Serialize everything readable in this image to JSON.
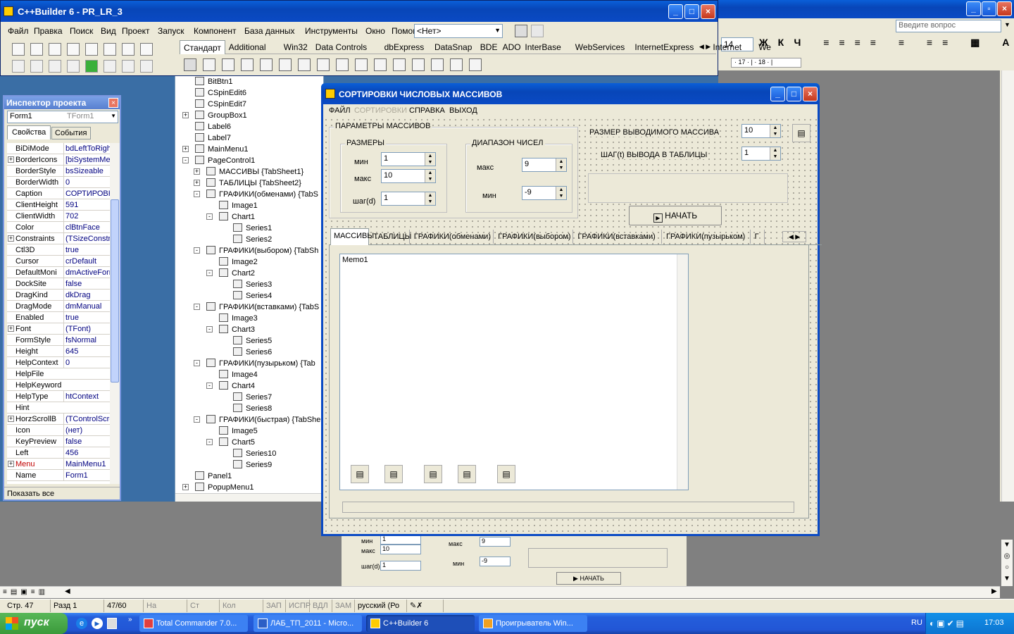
{
  "ide": {
    "title": "C++Builder 6 - PR_LR_3",
    "menu": [
      "Файл",
      "Правка",
      "Поиск",
      "Вид",
      "Проект",
      "Запуск",
      "Компонент",
      "База данных",
      "Инструменты",
      "Окно",
      "Помощь"
    ],
    "combo": "<Нет>",
    "palette_tabs": [
      "Стандарт",
      "Additional",
      "Win32",
      "Data Controls",
      "dbExpress",
      "DataSnap",
      "BDE",
      "ADO",
      "InterBase",
      "WebServices",
      "InternetExpress",
      "Internet",
      "We"
    ]
  },
  "word": {
    "question_placeholder": "Введите вопрос",
    "font_size": "14",
    "ruler": "· 17 · | · 18 · |"
  },
  "inspector": {
    "title": "Инспектор проекта",
    "object": "Form1",
    "object_type": "TForm1",
    "tab_props": "Свойства",
    "tab_events": "События",
    "footer": "Показать все",
    "rows": [
      {
        "name": "BiDiMode",
        "value": "bdLeftToRight",
        "plus": false
      },
      {
        "name": "BorderIcons",
        "value": "[biSystemMenu",
        "plus": true
      },
      {
        "name": "BorderStyle",
        "value": "bsSizeable",
        "plus": false
      },
      {
        "name": "BorderWidth",
        "value": "0",
        "plus": false
      },
      {
        "name": "Caption",
        "value": "СОРТИРОВКИ",
        "plus": false
      },
      {
        "name": "ClientHeight",
        "value": "591",
        "plus": false
      },
      {
        "name": "ClientWidth",
        "value": "702",
        "plus": false
      },
      {
        "name": "Color",
        "value": "clBtnFace",
        "plus": false
      },
      {
        "name": "Constraints",
        "value": "(TSizeConstrai",
        "plus": true
      },
      {
        "name": "Ctl3D",
        "value": "true",
        "plus": false
      },
      {
        "name": "Cursor",
        "value": "crDefault",
        "plus": false
      },
      {
        "name": "DefaultMoni",
        "value": "dmActiveForm",
        "plus": false
      },
      {
        "name": "DockSite",
        "value": "false",
        "plus": false
      },
      {
        "name": "DragKind",
        "value": "dkDrag",
        "plus": false
      },
      {
        "name": "DragMode",
        "value": "dmManual",
        "plus": false
      },
      {
        "name": "Enabled",
        "value": "true",
        "plus": false
      },
      {
        "name": "Font",
        "value": "(TFont)",
        "plus": true
      },
      {
        "name": "FormStyle",
        "value": "fsNormal",
        "plus": false
      },
      {
        "name": "Height",
        "value": "645",
        "plus": false
      },
      {
        "name": "HelpContext",
        "value": "0",
        "plus": false
      },
      {
        "name": "HelpFile",
        "value": "",
        "plus": false
      },
      {
        "name": "HelpKeyword",
        "value": "",
        "plus": false
      },
      {
        "name": "HelpType",
        "value": "htContext",
        "plus": false
      },
      {
        "name": "Hint",
        "value": "",
        "plus": false
      },
      {
        "name": "HorzScrollB",
        "value": "(TControlScroll",
        "plus": true
      },
      {
        "name": "Icon",
        "value": "(нет)",
        "plus": false
      },
      {
        "name": "KeyPreview",
        "value": "false",
        "plus": false
      },
      {
        "name": "Left",
        "value": "456",
        "plus": false
      },
      {
        "name": "Menu",
        "value": "MainMenu1",
        "plus": true
      },
      {
        "name": "Name",
        "value": "Form1",
        "plus": false
      }
    ]
  },
  "tree": [
    {
      "text": "BitBtn1",
      "level": 0,
      "exp": ""
    },
    {
      "text": "CSpinEdit6",
      "level": 0,
      "exp": ""
    },
    {
      "text": "CSpinEdit7",
      "level": 0,
      "exp": ""
    },
    {
      "text": "GroupBox1",
      "level": 0,
      "exp": "+"
    },
    {
      "text": "Label6",
      "level": 0,
      "exp": ""
    },
    {
      "text": "Label7",
      "level": 0,
      "exp": ""
    },
    {
      "text": "MainMenu1",
      "level": 0,
      "exp": "+"
    },
    {
      "text": "PageControl1",
      "level": 0,
      "exp": "-"
    },
    {
      "text": "МАССИВЫ {TabSheet1}",
      "level": 1,
      "exp": "+"
    },
    {
      "text": "ТАБЛИЦЫ {TabSheet2}",
      "level": 1,
      "exp": "+"
    },
    {
      "text": "ГРАФИКИ(обменами) {TabS",
      "level": 1,
      "exp": "-"
    },
    {
      "text": "Image1",
      "level": 2,
      "exp": ""
    },
    {
      "text": "Chart1",
      "level": 2,
      "exp": "-"
    },
    {
      "text": "Series1",
      "level": 3,
      "exp": ""
    },
    {
      "text": "Series2",
      "level": 3,
      "exp": ""
    },
    {
      "text": "ГРАФИКИ(выбором) {TabSh",
      "level": 1,
      "exp": "-"
    },
    {
      "text": "Image2",
      "level": 2,
      "exp": ""
    },
    {
      "text": "Chart2",
      "level": 2,
      "exp": "-"
    },
    {
      "text": "Series3",
      "level": 3,
      "exp": ""
    },
    {
      "text": "Series4",
      "level": 3,
      "exp": ""
    },
    {
      "text": "ГРАФИКИ(вставками) {TabS",
      "level": 1,
      "exp": "-"
    },
    {
      "text": "Image3",
      "level": 2,
      "exp": ""
    },
    {
      "text": "Chart3",
      "level": 2,
      "exp": "-"
    },
    {
      "text": "Series5",
      "level": 3,
      "exp": ""
    },
    {
      "text": "Series6",
      "level": 3,
      "exp": ""
    },
    {
      "text": "ГРАФИКИ(пузырьком) {Tab",
      "level": 1,
      "exp": "-"
    },
    {
      "text": "Image4",
      "level": 2,
      "exp": ""
    },
    {
      "text": "Chart4",
      "level": 2,
      "exp": "-"
    },
    {
      "text": "Series7",
      "level": 3,
      "exp": ""
    },
    {
      "text": "Series8",
      "level": 3,
      "exp": ""
    },
    {
      "text": "ГРАФИКИ(быстрая) {TabShe",
      "level": 1,
      "exp": "-"
    },
    {
      "text": "Image5",
      "level": 2,
      "exp": ""
    },
    {
      "text": "Chart5",
      "level": 2,
      "exp": "-"
    },
    {
      "text": "Series10",
      "level": 3,
      "exp": ""
    },
    {
      "text": "Series9",
      "level": 3,
      "exp": ""
    },
    {
      "text": "Panel1",
      "level": 0,
      "exp": ""
    },
    {
      "text": "PopupMenu1",
      "level": 0,
      "exp": "+"
    }
  ],
  "form": {
    "title": "СОРТИРОВКИ ЧИСЛОВЫХ МАССИВОВ",
    "menu": [
      "ФАЙЛ",
      "СОРТИРОВКИ",
      "СПРАВКА",
      "ВЫХОД"
    ],
    "params_label": "ПАРАМЕТРЫ МАССИВОВ",
    "sizes_label": "РАЗМЕРЫ",
    "min_label": "мин",
    "max_label": "макс",
    "step_label": "шаг(d)",
    "size_min": "1",
    "size_max": "10",
    "size_step": "1",
    "range_label": "ДИАПАЗОН ЧИСЕЛ",
    "range_max_label": "макс",
    "range_min_label": "мин",
    "range_max": "9",
    "range_min": "-9",
    "output_size_label": "РАЗМЕР ВЫВОДИМОГО МАССИВА",
    "output_size": "10",
    "step_table_label": "ШАГ(t) ВЫВОДА В ТАБЛИЦЫ",
    "step_table": "1",
    "start_label": "НАЧАТЬ",
    "tabs": [
      "МАССИВЫ",
      "ТАБЛИЦЫ",
      "ГРАФИКИ(обменами)",
      "ГРАФИКИ(выбором)",
      "ГРАФИКИ(вставками)",
      "ГРАФИКИ(пузырьком)",
      "Г"
    ],
    "memo": "Memo1"
  },
  "behind": {
    "min": "мин",
    "max": "макс",
    "step": "шаг(d)",
    "v10": "10",
    "v1": "1",
    "v9": "9",
    "vm9": "-9",
    "rmax": "макс",
    "rmin": "мин",
    "start": "НАЧАТЬ"
  },
  "status": {
    "line": "Стр. 47",
    "section": "Разд 1",
    "pages": "47/60",
    "at": "На",
    "col": "Ст",
    "kol": "Кол",
    "zap": "ЗАП",
    "ispr": "ИСПР",
    "vdl": "ВДЛ",
    "zam": "ЗАМ",
    "lang": "русский (Ро"
  },
  "taskbar": {
    "start": "пуск",
    "items": [
      "Total Commander 7.0...",
      "ЛАБ_ТП_2011 - Micro...",
      "C++Builder 6",
      "Проигрыватель Win..."
    ],
    "lang": "RU",
    "time": "17:03"
  }
}
